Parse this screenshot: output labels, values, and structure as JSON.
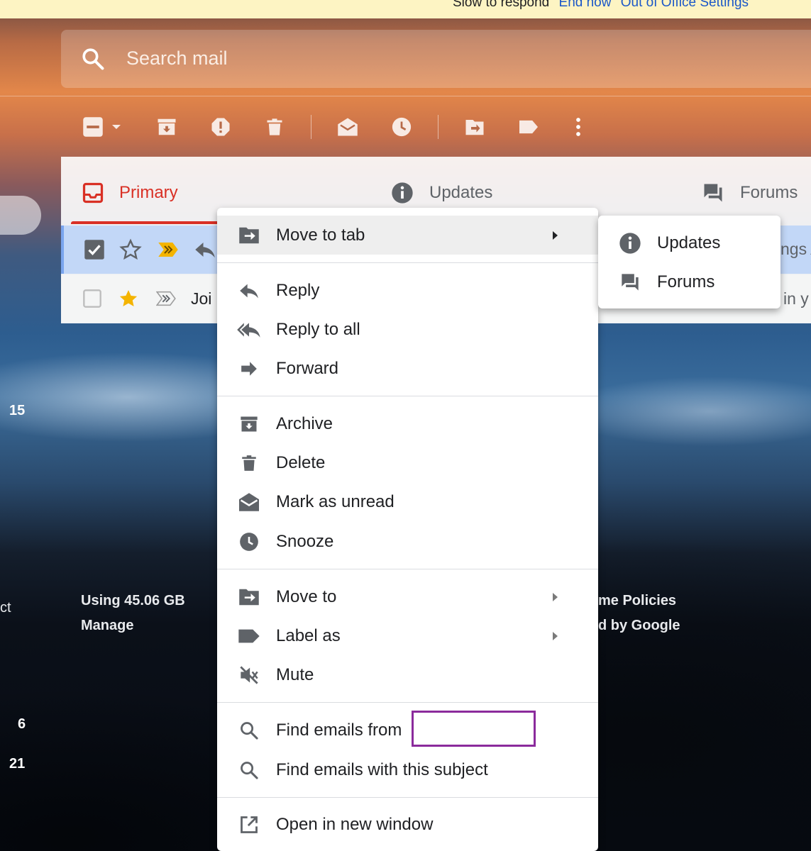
{
  "banner": {
    "text": "Slow to respond",
    "end_now": "End now",
    "ooo_settings": "Out of Office Settings"
  },
  "search": {
    "placeholder": "Search mail"
  },
  "tabs": {
    "primary": "Primary",
    "updates": "Updates",
    "forums": "Forums"
  },
  "rows": [
    {
      "snippet_right": "ngs A"
    },
    {
      "sender": "Joi",
      "snippet_right": "in y"
    }
  ],
  "side": {
    "num1": "15",
    "num2": "6",
    "num3": "21",
    "cut": "ct"
  },
  "footer": {
    "storage": "Using 45.06 GB",
    "manage": "Manage",
    "policies": "me Policies",
    "powered": "d by Google"
  },
  "context_menu": {
    "move_to_tab": "Move to tab",
    "reply": "Reply",
    "reply_all": "Reply to all",
    "forward": "Forward",
    "archive": "Archive",
    "delete": "Delete",
    "mark_unread": "Mark as unread",
    "snooze": "Snooze",
    "move_to": "Move to",
    "label_as": "Label as",
    "mute": "Mute",
    "find_from": "Find emails from",
    "find_subject": "Find emails with this subject",
    "open_new_window": "Open in new window"
  },
  "submenu": {
    "updates": "Updates",
    "forums": "Forums"
  },
  "colors": {
    "accent_red": "#d93025",
    "link_blue": "#1a57c8",
    "highlight_row": "#c2d7f7",
    "redaction_border": "#8b2b9c"
  }
}
